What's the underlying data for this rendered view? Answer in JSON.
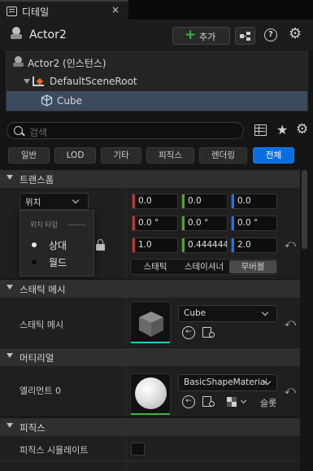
{
  "tab": {
    "title": "디테일",
    "close": "×"
  },
  "header": {
    "actor_name": "Actor2",
    "add_label": "추가",
    "add_plus": "+",
    "help": "?"
  },
  "tree": {
    "items": [
      {
        "label": "Actor2 (인스턴스)"
      },
      {
        "label": "DefaultSceneRoot"
      },
      {
        "label": "Cube"
      }
    ]
  },
  "search": {
    "placeholder": "검색"
  },
  "filters": [
    "일반",
    "LOD",
    "기타",
    "피직스",
    "렌더링",
    "전체"
  ],
  "transform": {
    "title": "트랜스폼",
    "location_dropdown": "위치",
    "location": [
      "0.0",
      "0.0",
      "0.0"
    ],
    "rotation": [
      "0.0 °",
      "0.0 °",
      "0.0 °"
    ],
    "scale": [
      "1.0",
      "0.444444",
      "2.0"
    ],
    "popup": {
      "header": "위치 타입",
      "options": [
        "상대",
        "월드"
      ]
    },
    "mobility": [
      "스태틱",
      "스테이셔너",
      "무버블"
    ]
  },
  "static_mesh": {
    "title": "스태틱 메시",
    "label": "스태틱 메시",
    "value": "Cube"
  },
  "materials": {
    "title": "머티리얼",
    "label": "엘리먼트 0",
    "value": "BasicShapeMaterial",
    "slot": "슬롯"
  },
  "physics": {
    "title": "피직스",
    "label": "피직스 시뮬레이트"
  },
  "colors": {
    "x_axis": "#c8332c",
    "y_axis": "#5aa02c",
    "z_axis": "#2f6fd8",
    "accent": "#0b6ee0"
  }
}
